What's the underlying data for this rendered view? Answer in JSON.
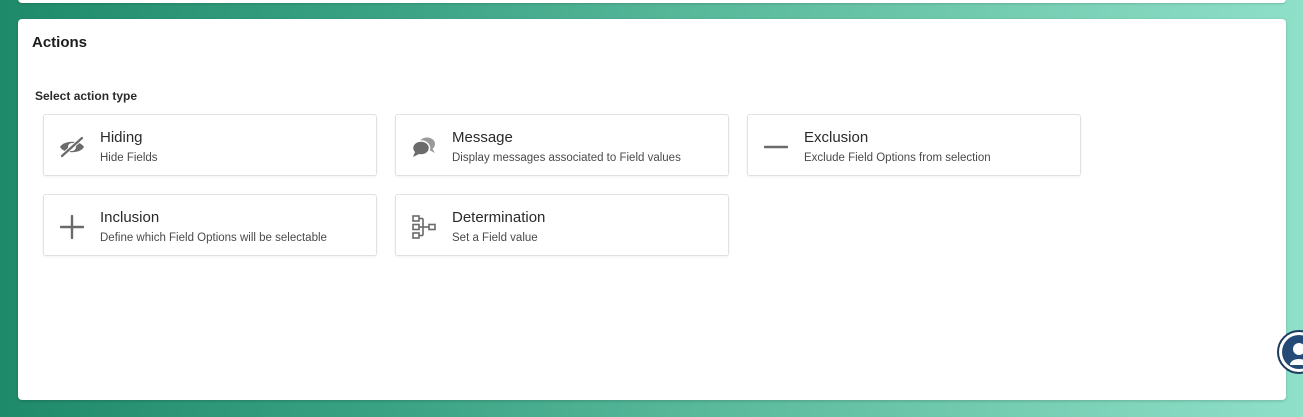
{
  "panel": {
    "title": "Actions",
    "section_label": "Select action type"
  },
  "action_types": [
    {
      "title": "Hiding",
      "description": "Hide Fields",
      "icon": "eye-slash-icon"
    },
    {
      "title": "Message",
      "description": "Display messages associated to Field values",
      "icon": "chat-bubbles-icon"
    },
    {
      "title": "Exclusion",
      "description": "Exclude Field Options from selection",
      "icon": "minus-icon"
    },
    {
      "title": "Inclusion",
      "description": "Define which Field Options will be selectable",
      "icon": "plus-icon"
    },
    {
      "title": "Determination",
      "description": "Set a Field value",
      "icon": "hierarchy-icon"
    }
  ],
  "colors": {
    "icon": "#6b6b6b",
    "background_start": "#1f8a6a",
    "background_end": "#8fe0c8",
    "fab_border": "#1e3a5f"
  },
  "assistant_button_icon": "assistant-avatar-icon"
}
